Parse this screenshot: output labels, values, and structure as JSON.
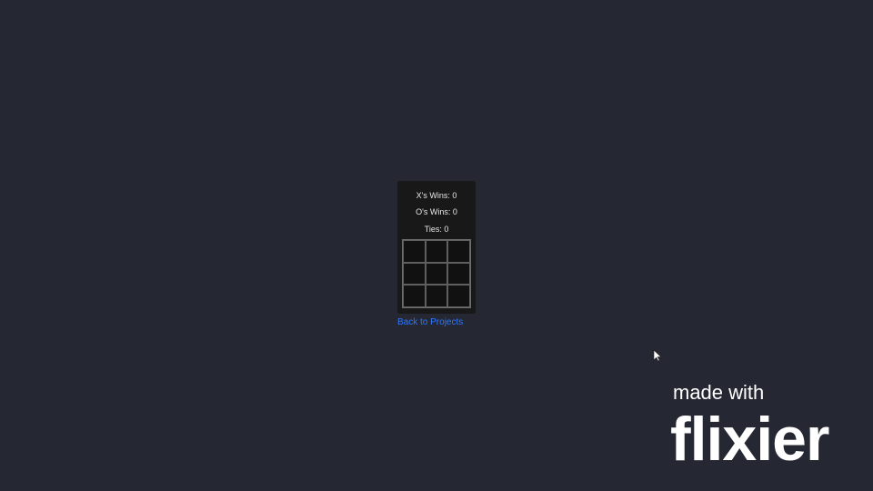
{
  "scoreboard": {
    "x_wins": "X's Wins: 0",
    "o_wins": "O's Wins: 0",
    "ties": "Ties: 0"
  },
  "board": {
    "cells": [
      "",
      "",
      "",
      "",
      "",
      "",
      "",
      "",
      ""
    ]
  },
  "navigation": {
    "back_link": "Back to Projects"
  },
  "watermark": {
    "line1": "made with",
    "line2": "flixier"
  },
  "theme": {
    "background": "#252832",
    "card": "#181818",
    "link": "#2f76ff",
    "text": "#e8e8e8"
  }
}
